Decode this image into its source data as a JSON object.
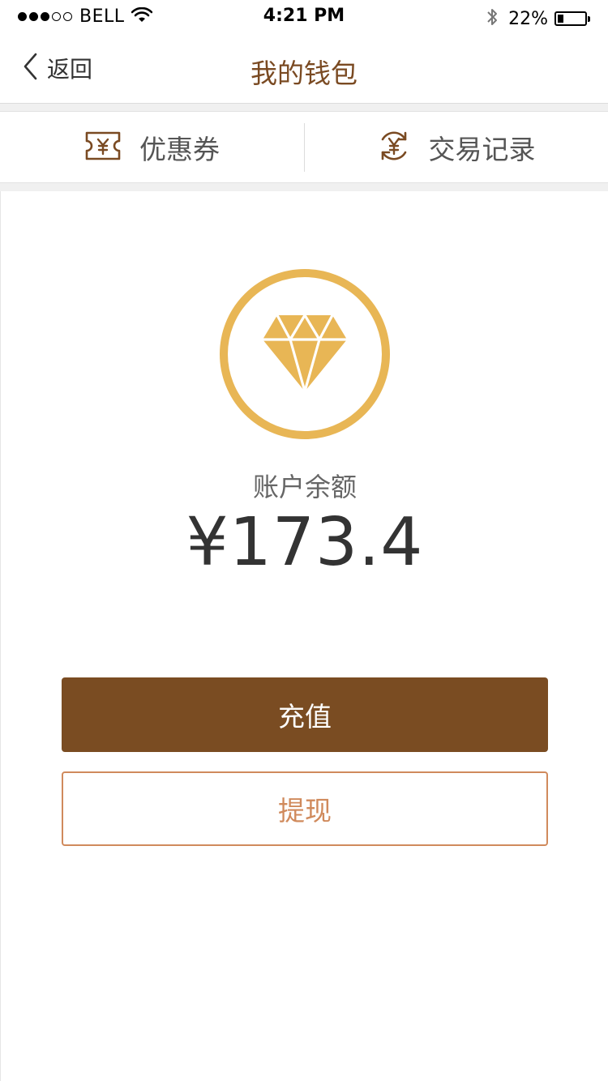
{
  "status_bar": {
    "carrier": "BELL",
    "time": "4:21 PM",
    "battery_percent": "22%",
    "signal_bars_filled": 3,
    "signal_bars_total": 5,
    "battery_level": 0.22
  },
  "nav": {
    "back_label": "返回",
    "title": "我的钱包"
  },
  "tabs": [
    {
      "label": "优惠券",
      "icon": "coupon-icon"
    },
    {
      "label": "交易记录",
      "icon": "transaction-history-icon"
    }
  ],
  "wallet": {
    "balance_label": "账户余额",
    "balance_amount": "¥173.4",
    "icon": "diamond-icon"
  },
  "actions": {
    "recharge_label": "充值",
    "withdraw_label": "提现"
  },
  "colors": {
    "brand_brown": "#7a4c22",
    "title_brown": "#7a4a22",
    "gold": "#e8b655",
    "withdraw_accent": "#d08a5c"
  }
}
